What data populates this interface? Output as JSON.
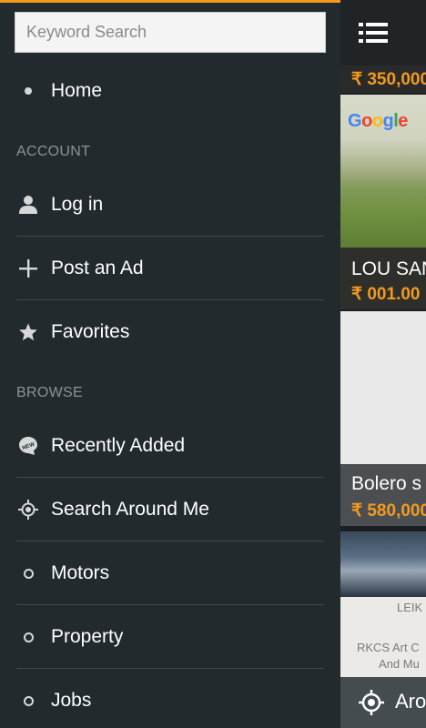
{
  "search": {
    "placeholder": "Keyword Search",
    "value": ""
  },
  "menu": {
    "home": "Home",
    "account_header": "ACCOUNT",
    "login": "Log in",
    "post_ad": "Post an Ad",
    "favorites": "Favorites",
    "browse_header": "BROWSE",
    "recently_added": "Recently Added",
    "search_around": "Search Around Me",
    "motors": "Motors",
    "property": "Property",
    "jobs": "Jobs"
  },
  "background": {
    "top_price": "₹ 350,000",
    "card1_title": "LOU SAN",
    "card1_price": "₹ 001.00",
    "card2_title": "Bolero s",
    "card2_price": "₹ 580,000",
    "map_label_1": "LEIK",
    "map_label_2": "RKCS Art C",
    "map_label_3": "And Mu",
    "bottom_label": "Aro"
  },
  "colors": {
    "accent": "#f39a1d",
    "drawer_bg": "#222a2d"
  },
  "icons": {
    "home": "dot-icon",
    "login": "user-icon",
    "post_ad": "plus-icon",
    "favorites": "star-icon",
    "recently_added": "new-badge-icon",
    "search_around": "location-target-icon",
    "category": "circle-icon",
    "menu": "list-menu-icon"
  }
}
